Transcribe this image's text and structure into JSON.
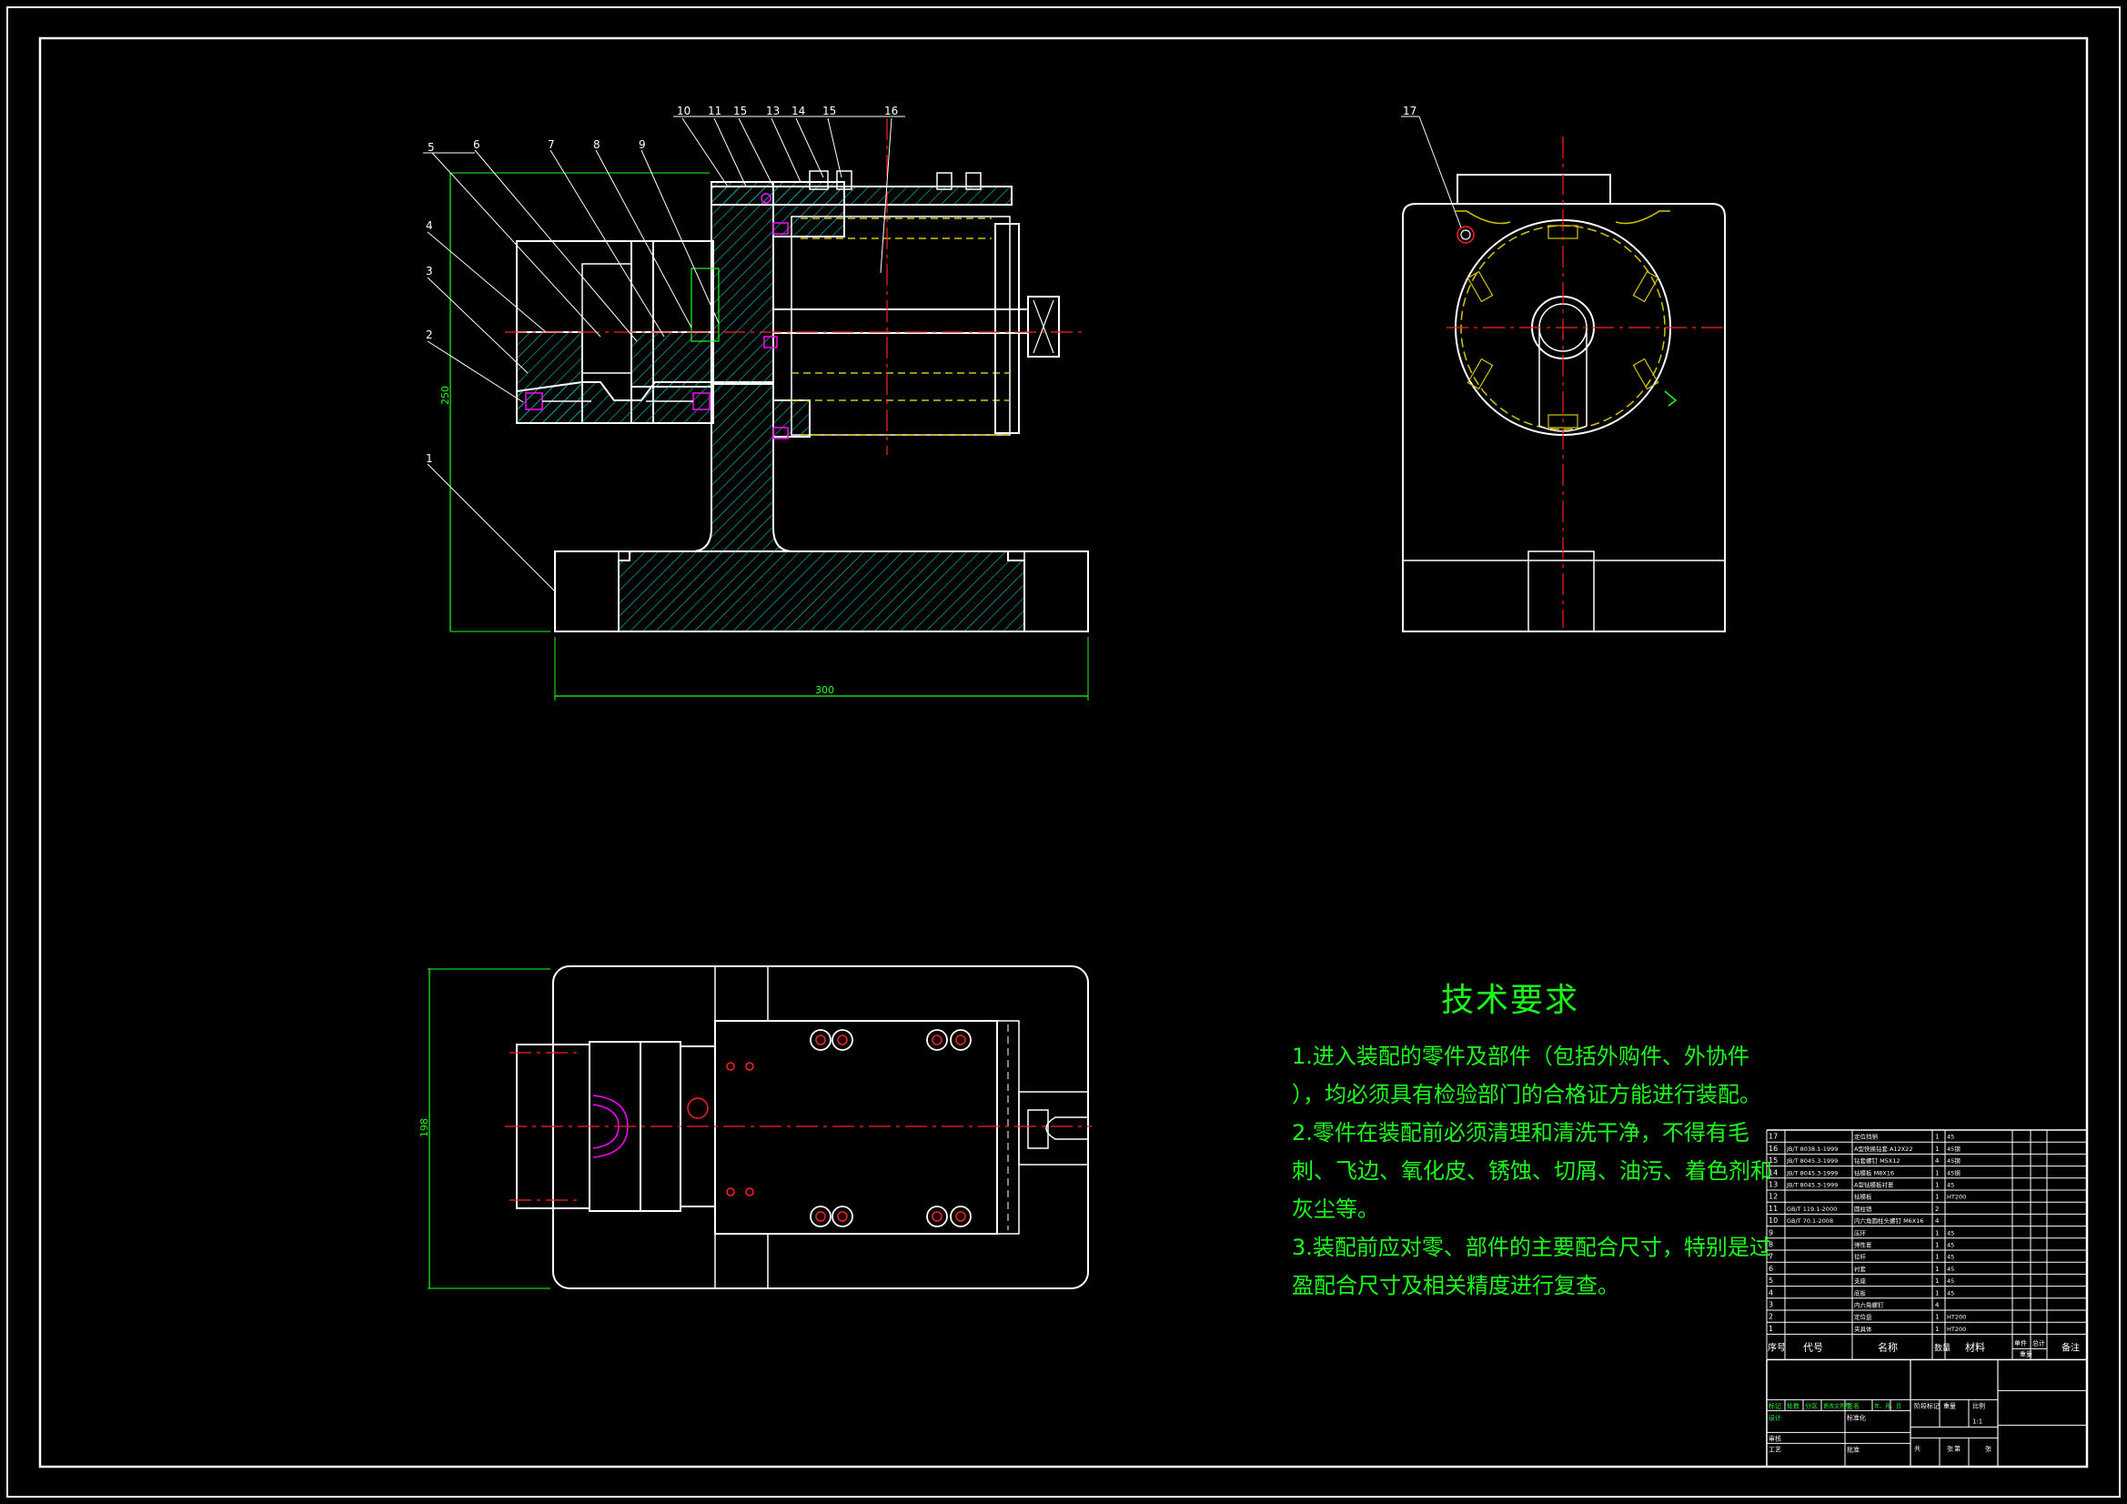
{
  "balloons": {
    "front": [
      "10",
      "11",
      "15",
      "13",
      "14",
      "15",
      "16",
      "5",
      "6",
      "7",
      "8",
      "9",
      "4",
      "3",
      "2",
      "1"
    ],
    "side": [
      "17"
    ]
  },
  "dimensions": {
    "front_height": "250",
    "front_width": "300",
    "top_height": "198"
  },
  "tech": {
    "title": "技术要求",
    "lines": [
      "1.进入装配的零件及部件（包括外购件、外协件",
      "），均必须具有检验部门的合格证方能进行装配。",
      "2.零件在装配前必须清理和清洗干净，不得有毛",
      "刺、飞边、氧化皮、锈蚀、切屑、油污、着色剂和",
      "灰尘等。",
      "3.装配前应对零、部件的主要配合尺寸，特别是过",
      "盈配合尺寸及相关精度进行复查。"
    ]
  },
  "bom": {
    "headers": [
      "序号",
      "代号",
      "名称",
      "数量",
      "材料",
      "单件",
      "总计",
      "重量",
      "备注"
    ],
    "rows": [
      [
        "17",
        "",
        "定位挡销",
        "1",
        "45",
        ""
      ],
      [
        "16",
        "JB/T 8038.1-1999",
        "A型快换钻套 A12X22",
        "1",
        "45钢",
        ""
      ],
      [
        "15",
        "JB/T 8045.3-1999",
        "钻套螺钉 M5X12",
        "4",
        "45钢",
        ""
      ],
      [
        "14",
        "JB/T 8045.3-1999",
        "钻模板 M8X16",
        "1",
        "45钢",
        ""
      ],
      [
        "13",
        "JB/T 8045.3-1999",
        "A型钻模板衬套",
        "1",
        "45",
        ""
      ],
      [
        "12",
        "",
        "钻模板",
        "1",
        "HT200",
        ""
      ],
      [
        "11",
        "GB/T 119.1-2000",
        "圆柱销",
        "2",
        "",
        ""
      ],
      [
        "10",
        "GB/T 70.1-2008",
        "内六角圆柱头螺钉 M6X16",
        "4",
        "",
        ""
      ],
      [
        "9",
        "",
        "压环",
        "1",
        "45",
        ""
      ],
      [
        "8",
        "",
        "弹性套",
        "1",
        "45",
        ""
      ],
      [
        "7",
        "",
        "拉杆",
        "1",
        "45",
        ""
      ],
      [
        "6",
        "",
        "衬套",
        "1",
        "45",
        ""
      ],
      [
        "5",
        "",
        "支座",
        "1",
        "45",
        ""
      ],
      [
        "4",
        "",
        "底板",
        "1",
        "45",
        ""
      ],
      [
        "3",
        "",
        "内六角螺钉",
        "4",
        "",
        ""
      ],
      [
        "2",
        "",
        "定位盘",
        "1",
        "HT200",
        ""
      ],
      [
        "1",
        "",
        "夹具体",
        "1",
        "HT200",
        ""
      ]
    ],
    "title_block": {
      "design": "设计",
      "review": "审核",
      "process": "工艺",
      "approve": "批准",
      "stage_mark": "阶段标记",
      "weight": "重量",
      "scale": "比例",
      "scale_value": "1:1",
      "sheet_total": "共",
      "sheet_no": "第",
      "sheet_unit": "张",
      "mark": "标记",
      "count": "处数",
      "zone": "分区",
      "change_doc": "更改文件号",
      "sign": "签名",
      "date": "年、月、日",
      "standard": "标准化"
    }
  },
  "colors": {
    "outline": "#ffffff",
    "hatch": "#00c8c8",
    "dim": "#1aff1a",
    "center": "#ff2020",
    "hidden": "#d6c400",
    "magenta": "#ff00ff"
  }
}
